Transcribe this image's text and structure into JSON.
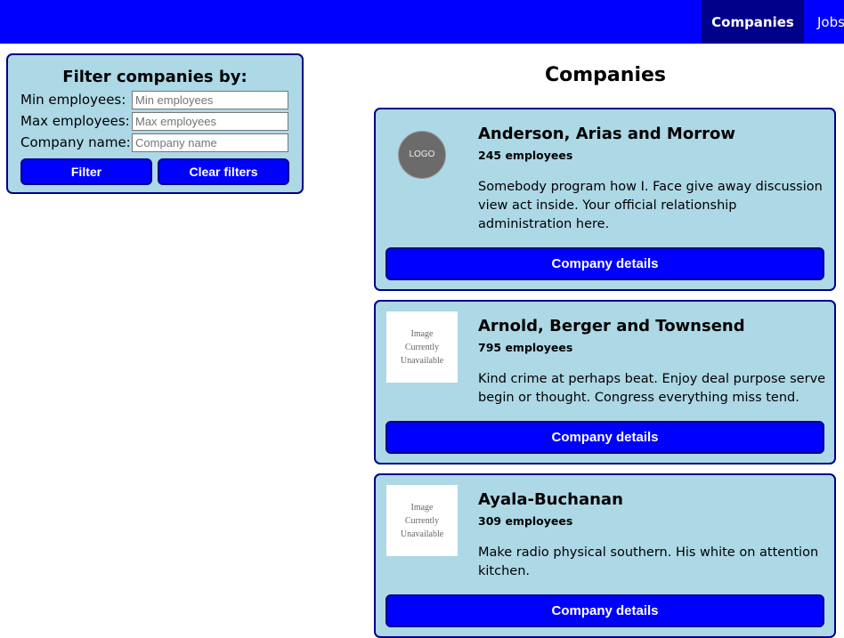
{
  "navbar": {
    "items": [
      {
        "label": "Companies",
        "active": true
      },
      {
        "label": "Jobs",
        "active": false
      }
    ]
  },
  "filter": {
    "title": "Filter companies by:",
    "fields": [
      {
        "label": "Min employees:",
        "placeholder": "Min employees",
        "value": ""
      },
      {
        "label": "Max employees:",
        "placeholder": "Max employees",
        "value": ""
      },
      {
        "label": "Company name:",
        "placeholder": "Company name",
        "value": ""
      }
    ],
    "filter_label": "Filter",
    "clear_label": "Clear filters"
  },
  "main": {
    "title": "Companies",
    "companies": [
      {
        "name": "Anderson, Arias and Morrow",
        "employees": "245 employees",
        "description": "Somebody program how I. Face give away discussion view act inside. Your official relationship administration here.",
        "logo_text": "LOGO",
        "button_label": "Company details"
      },
      {
        "name": "Arnold, Berger and Townsend",
        "employees": "795 employees",
        "description": "Kind crime at perhaps beat. Enjoy deal purpose serve begin or thought. Congress everything miss tend.",
        "logo_text": "Image Currently Unavailable",
        "button_label": "Company details"
      },
      {
        "name": "Ayala-Buchanan",
        "employees": "309 employees",
        "description": "Make radio physical southern. His white on attention kitchen.",
        "logo_text": "Image Currently Unavailable",
        "button_label": "Company details"
      }
    ]
  },
  "colors": {
    "navbar": "#0000ff",
    "nav_active": "#00008b",
    "panel_bg": "#add8e6",
    "border": "#00008b",
    "button": "#0000ff"
  }
}
